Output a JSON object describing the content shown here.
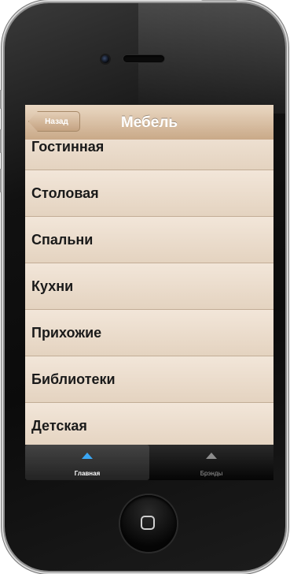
{
  "app": {
    "nav_title": "Мебель",
    "back_label": "Назад"
  },
  "list": {
    "items": [
      {
        "label": "Гостинная"
      },
      {
        "label": "Столовая"
      },
      {
        "label": "Спальни"
      },
      {
        "label": "Кухни"
      },
      {
        "label": "Прихожие"
      },
      {
        "label": "Библиотеки"
      },
      {
        "label": "Детская"
      }
    ]
  },
  "tabbar": {
    "tabs": [
      {
        "label": "Главная",
        "active": true,
        "icon": "triangle-up-icon"
      },
      {
        "label": "Брэнды",
        "active": false,
        "icon": "triangle-up-icon"
      }
    ]
  },
  "colors": {
    "nav_bar": "#d6b99b",
    "row": "#ecdccb",
    "tab_active_icon": "#3aa7f5"
  }
}
